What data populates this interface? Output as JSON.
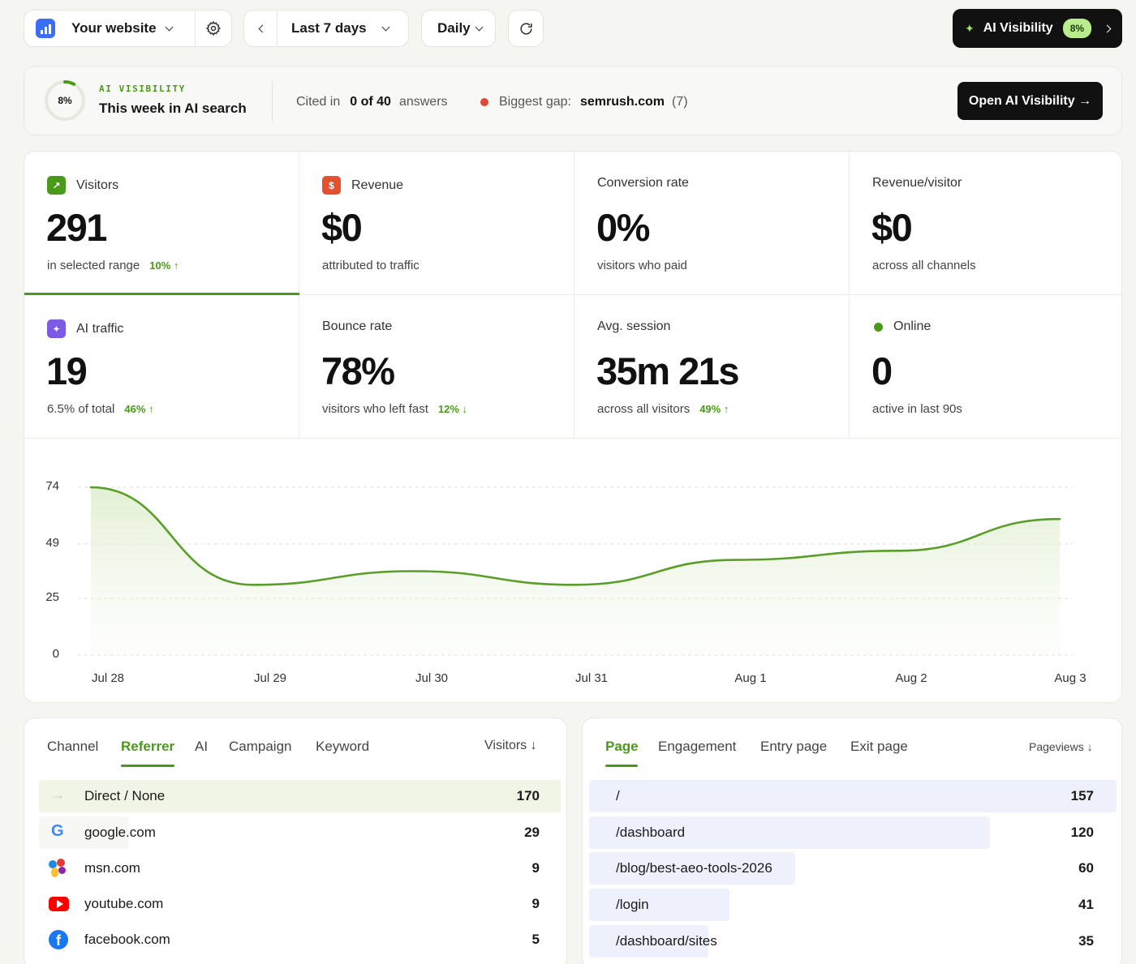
{
  "toolbar": {
    "site_name": "Your website",
    "date_range": "Last 7 days",
    "granularity": "Daily",
    "ai_visibility_label": "AI Visibility",
    "ai_visibility_badge": "8%"
  },
  "banner": {
    "ring_percent": "8%",
    "ring_value": 0.08,
    "kicker": "AI VISIBILITY",
    "title": "This week in AI search",
    "cited_prefix": "Cited in",
    "cited_value": "0 of 40",
    "cited_suffix": "answers",
    "gap_label": "Biggest gap:",
    "gap_domain": "semrush.com",
    "gap_count": "(7)",
    "open_button": "Open AI Visibility →"
  },
  "stats": [
    {
      "label": "Visitors",
      "value": "291",
      "sub": "in selected range",
      "change": "10% ↑"
    },
    {
      "label": "Revenue",
      "value": "$0",
      "sub": "attributed to traffic",
      "change": ""
    },
    {
      "label": "Conversion rate",
      "value": "0%",
      "sub": "visitors who paid",
      "change": ""
    },
    {
      "label": "Revenue/visitor",
      "value": "$0",
      "sub": "across all channels",
      "change": ""
    },
    {
      "label": "AI traffic",
      "value": "19",
      "sub": "6.5% of total",
      "change": "46% ↑"
    },
    {
      "label": "Bounce rate",
      "value": "78%",
      "sub": "visitors who left fast",
      "change": "12% ↓"
    },
    {
      "label": "Avg. session",
      "value": "35m 21s",
      "sub": "across all visitors",
      "change": "49% ↑"
    },
    {
      "label": "Online",
      "value": "0",
      "sub": "active in last 90s",
      "change": ""
    }
  ],
  "chart_data": {
    "type": "area",
    "x": [
      "Jul 28",
      "Jul 29",
      "Jul 30",
      "Jul 31",
      "Aug 1",
      "Aug 2",
      "Aug 3"
    ],
    "series": [
      {
        "values": [
          74,
          31,
          37,
          31,
          42,
          46,
          60
        ]
      }
    ],
    "yticks": [
      "74",
      "49",
      "25",
      "0"
    ],
    "ylim": [
      0,
      74
    ],
    "grid": true,
    "color": "#5a9e2a"
  },
  "left_panel": {
    "tabs": [
      "Channel",
      "Referrer",
      "AI",
      "Campaign",
      "Keyword"
    ],
    "active_tab": "Referrer",
    "sort_label": "Visitors ↓",
    "rows": [
      {
        "icon": "arrow-right-icon",
        "label": "Direct / None",
        "value": "170",
        "share": 1.0
      },
      {
        "icon": "google-icon",
        "label": "google.com",
        "value": "29",
        "share": 0.17
      },
      {
        "icon": "msn-icon",
        "label": "msn.com",
        "value": "9",
        "share": 0.05
      },
      {
        "icon": "youtube-icon",
        "label": "youtube.com",
        "value": "9",
        "share": 0.05
      },
      {
        "icon": "facebook-icon",
        "label": "facebook.com",
        "value": "5",
        "share": 0.03
      }
    ]
  },
  "right_panel": {
    "tabs": [
      "Page",
      "Engagement",
      "Entry page",
      "Exit page"
    ],
    "active_tab": "Page",
    "sort_label": "Pageviews ↓",
    "rows": [
      {
        "label": "/",
        "value": "157",
        "share": 1.0
      },
      {
        "label": "/dashboard",
        "value": "120",
        "share": 0.76
      },
      {
        "label": "/blog/best-aeo-tools-2026",
        "value": "60",
        "share": 0.39
      },
      {
        "label": "/login",
        "value": "41",
        "share": 0.27
      },
      {
        "label": "/dashboard/sites",
        "value": "35",
        "share": 0.23
      }
    ]
  },
  "colors": {
    "accent": "#4a9a1a",
    "dark": "#111111",
    "gap_dot": "#e0483a",
    "page_bar": "#eef1fb",
    "ref_bar": "#f1f5e6"
  }
}
